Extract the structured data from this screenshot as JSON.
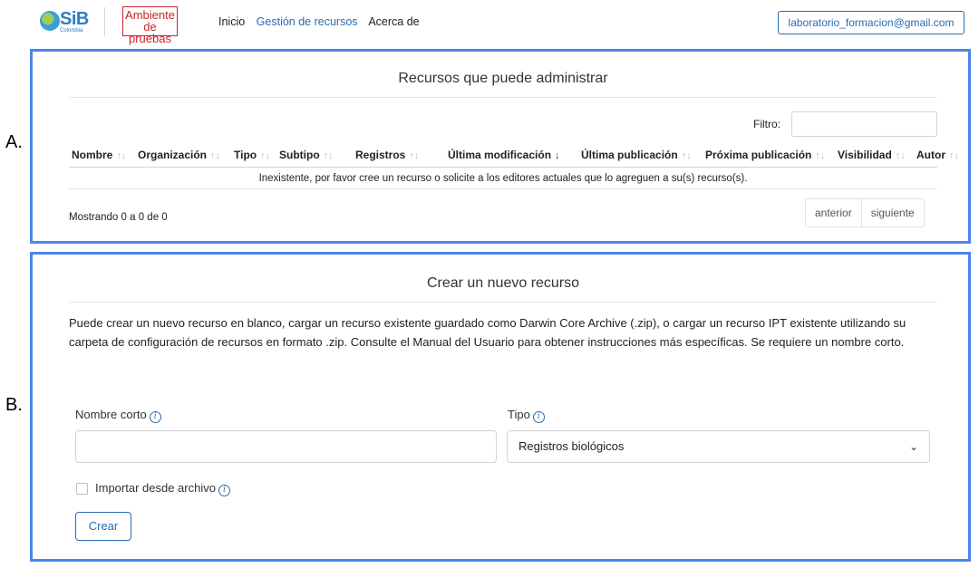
{
  "header": {
    "logo_text": "SiB",
    "logo_sub": "Colombia",
    "sandbox_line1": "Ambiente",
    "sandbox_line2": "de pruebas",
    "nav": [
      "Inicio",
      "Gestión de recursos",
      "Acerca de"
    ],
    "nav_active": "Gestión de recursos",
    "user_email": "laboratorio_formacion@gmail.com"
  },
  "markers": {
    "a": "A.",
    "b": "B."
  },
  "resources_panel": {
    "title": "Recursos que puede administrar",
    "filter_label": "Filtro:",
    "filter_value": "",
    "columns": [
      "Nombre",
      "Organización",
      "Tipo",
      "Subtipo",
      "Registros",
      "Última modificación",
      "Última publicación",
      "Próxima publicación",
      "Visibilidad",
      "Autor"
    ],
    "sort_icon_default": "↑↓",
    "sort_icon_active": "↓",
    "empty_message": "Inexistente, por favor cree un recurso o solicite a los editores actuales que lo agreguen a su(s) recurso(s).",
    "info": "Mostrando 0 a 0 de 0",
    "prev_label": "anterior",
    "next_label": "siguiente"
  },
  "create_panel": {
    "title": "Crear un nuevo recurso",
    "description": "Puede crear un nuevo recurso en blanco, cargar un recurso existente guardado como Darwin Core Archive (.zip), o cargar un recurso IPT existente utilizando su carpeta de configuración de recursos en formato .zip. Consulte el Manual del Usuario para obtener instrucciones más específicas. Se requiere un nombre corto.",
    "shortname_label": "Nombre corto",
    "shortname_value": "",
    "type_label": "Tipo",
    "type_value": "Registros biológicos",
    "import_label": "Importar desde archivo",
    "import_checked": false,
    "create_label": "Crear",
    "info_glyph": "i"
  },
  "colors": {
    "accent": "#2b6cb0",
    "highlight_border": "#4a86e8",
    "sandbox_red": "#c8232c"
  }
}
